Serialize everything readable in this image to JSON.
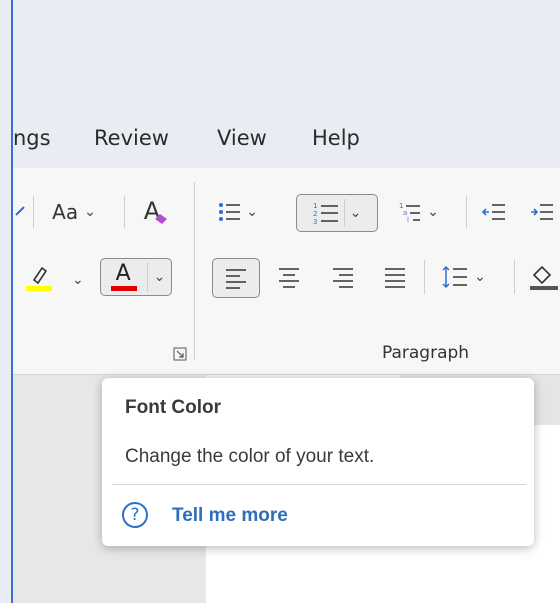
{
  "tabs": {
    "references_partial": "ngs",
    "review": "Review",
    "view": "View",
    "help": "Help"
  },
  "font_group": {
    "change_case_label": "Aa",
    "clear_formatting_icon": "A",
    "font_color_letter": "A",
    "font_color_bar": "#e00000",
    "highlight_bar": "#ffff00"
  },
  "paragraph_group": {
    "label": "Paragraph"
  },
  "tooltip": {
    "title": "Font Color",
    "description": "Change the color of your text.",
    "help_icon": "?",
    "link": "Tell me more"
  }
}
